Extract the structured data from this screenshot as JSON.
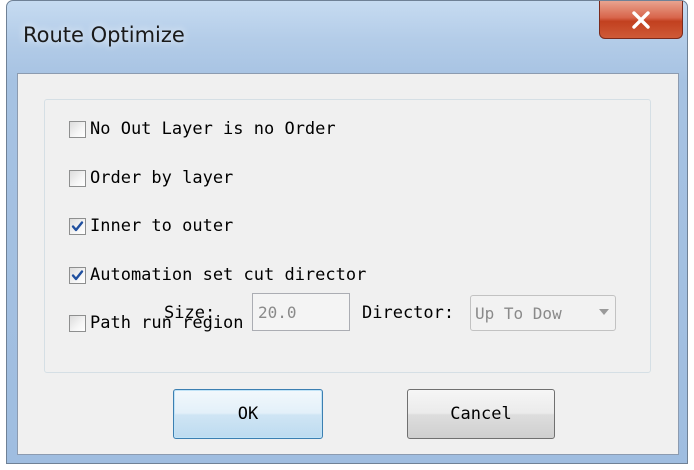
{
  "window": {
    "title": "Route Optimize"
  },
  "options": [
    {
      "label": "No Out Layer is no Order",
      "checked": false
    },
    {
      "label": "Order by layer",
      "checked": false
    },
    {
      "label": "Inner to outer",
      "checked": true
    },
    {
      "label": "Automation set cut director",
      "checked": true
    },
    {
      "label": "Path run region",
      "checked": false
    }
  ],
  "region": {
    "size_label": "Size:",
    "size_value": "20.0",
    "director_label": "Director:",
    "director_value": "Up To Dow"
  },
  "buttons": {
    "ok_label": "OK",
    "cancel_label": "Cancel"
  },
  "colors": {
    "check_mark": "#1f4f9f",
    "close_button": "#c7472a",
    "ok_border": "#3c7fb1"
  },
  "icons": {
    "close": "close-icon",
    "check": "checkmark-icon",
    "dropdown": "chevron-down-icon"
  }
}
